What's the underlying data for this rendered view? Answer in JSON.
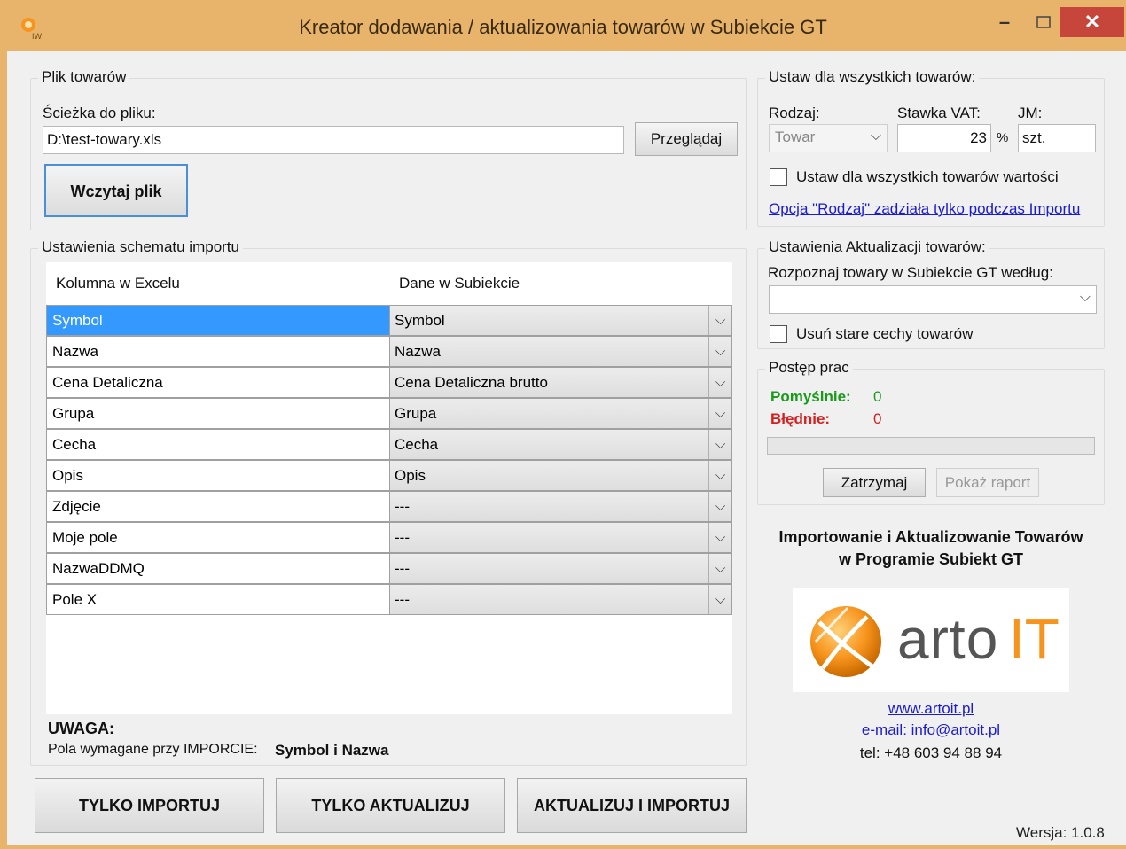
{
  "window": {
    "title": "Kreator dodawania / aktualizowania towarów w Subiekcie GT"
  },
  "file_group": {
    "legend": "Plik towarów",
    "path_label": "Ścieżka do pliku:",
    "path_value": "D:\\test-towary.xls",
    "browse_label": "Przeglądaj",
    "load_label": "Wczytaj plik"
  },
  "schema_group": {
    "legend": "Ustawienia schematu importu",
    "col_excel": "Kolumna w Excelu",
    "col_subiekt": "Dane w Subiekcie",
    "rows": [
      {
        "excel": "Symbol",
        "subiekt": "Symbol"
      },
      {
        "excel": "Nazwa",
        "subiekt": "Nazwa"
      },
      {
        "excel": "Cena Detaliczna",
        "subiekt": "Cena Detaliczna brutto"
      },
      {
        "excel": "Grupa",
        "subiekt": "Grupa"
      },
      {
        "excel": "Cecha",
        "subiekt": "Cecha"
      },
      {
        "excel": "Opis",
        "subiekt": "Opis"
      },
      {
        "excel": "Zdjęcie",
        "subiekt": "---"
      },
      {
        "excel": "Moje pole",
        "subiekt": "---"
      },
      {
        "excel": "NazwaDDMQ",
        "subiekt": "---"
      },
      {
        "excel": "Pole X",
        "subiekt": "---"
      }
    ],
    "warning_title": "UWAGA:",
    "warning_text": "Pola wymagane przy IMPORCIE:",
    "warning_fields": "Symbol i Nazwa"
  },
  "all_group": {
    "legend": "Ustaw dla wszystkich towarów:",
    "type_label": "Rodzaj:",
    "type_value": "Towar",
    "vat_label": "Stawka VAT:",
    "vat_value": "23",
    "vat_unit": "%",
    "unit_label": "JM:",
    "unit_value": "szt.",
    "checkbox_label": "Ustaw dla wszystkich towarów wartości",
    "note_link": "Opcja \"Rodzaj\" zadziała tylko podczas Importu"
  },
  "update_group": {
    "legend": "Ustawienia Aktualizacji towarów:",
    "identify_label": "Rozpoznaj towary w Subiekcie GT według:",
    "identify_value": "",
    "remove_label": "Usuń stare cechy towarów"
  },
  "progress_group": {
    "legend": "Postęp prac",
    "ok_label": "Pomyślnie:",
    "ok_value": "0",
    "err_label": "Błędnie:",
    "err_value": "0",
    "progress_fraction": 0,
    "stop_label": "Zatrzymaj",
    "report_label": "Pokaż raport"
  },
  "branding": {
    "tagline_1": "Importowanie i Aktualizowanie Towarów",
    "tagline_2": "w Programie Subiekt GT",
    "logo_text_a": "arto",
    "logo_text_b": "IT",
    "website": "www.artoit.pl",
    "email": "e-mail: info@artoit.pl",
    "phone": "tel: +48 603 94 88 94",
    "version": "Wersja: 1.0.8"
  },
  "actions": {
    "import_only": "TYLKO IMPORTUJ",
    "update_only": "TYLKO AKTUALIZUJ",
    "update_import": "AKTUALIZUJ I IMPORTUJ"
  },
  "colors": {
    "titlebar": "#e8b36a",
    "close": "#c7463b",
    "selected_row": "#3399ff",
    "ok_green": "#1a9a1a",
    "err_red": "#d42020",
    "logo_orange": "#f7941d"
  }
}
